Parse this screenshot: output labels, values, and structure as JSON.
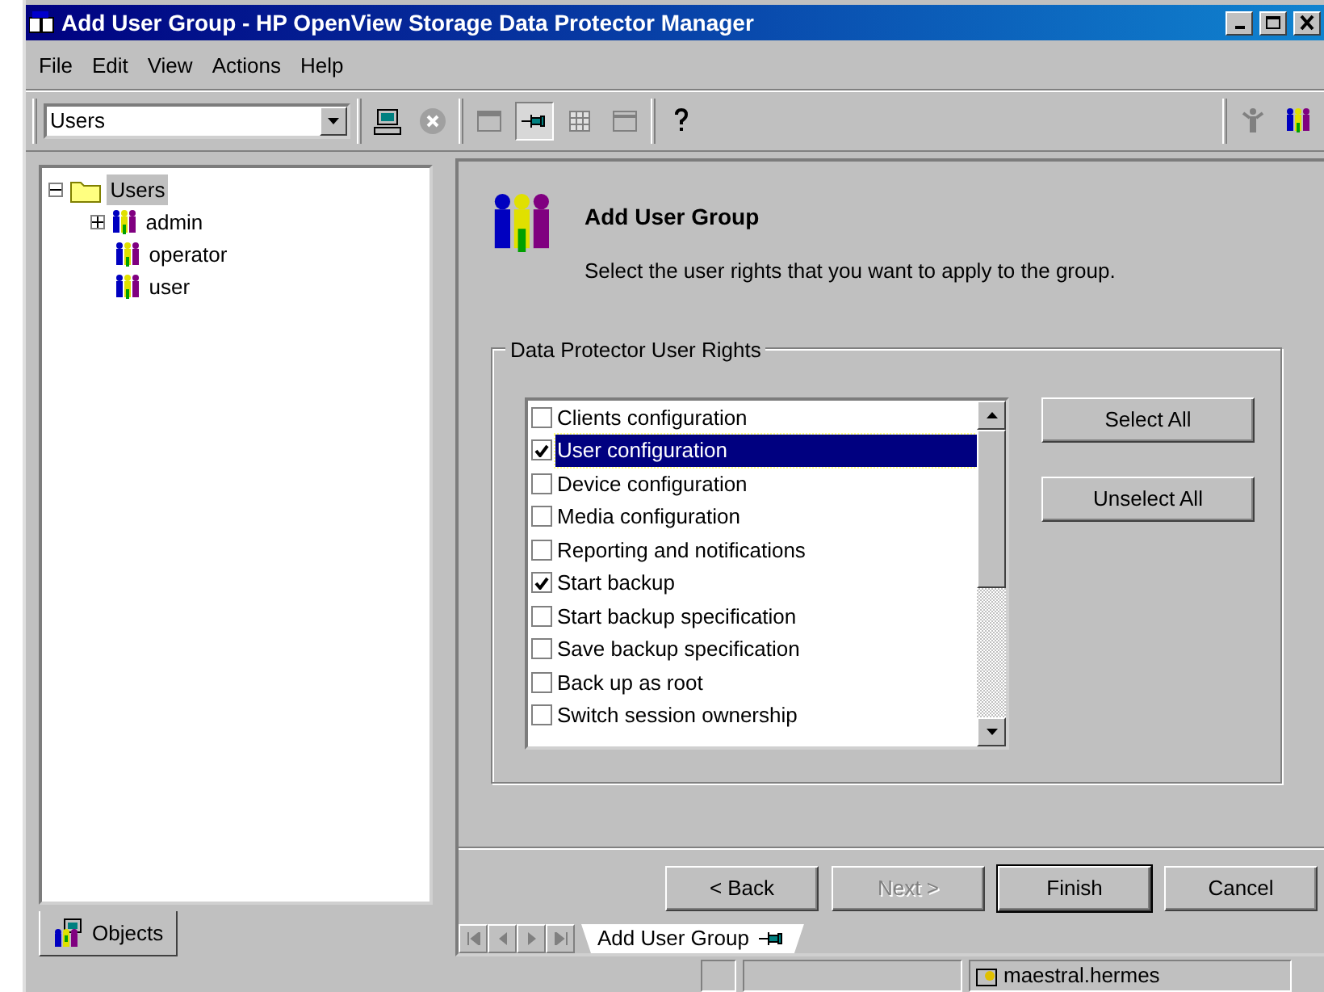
{
  "window": {
    "title": "Add User Group - HP OpenView Storage Data Protector Manager"
  },
  "menu": [
    "File",
    "Edit",
    "View",
    "Actions",
    "Help"
  ],
  "toolbar": {
    "context": {
      "value": "Users"
    }
  },
  "tree": [
    {
      "label": "Users",
      "selected": true,
      "expanded": true,
      "children": [
        {
          "label": "admin",
          "selected": false,
          "expanded": false
        },
        {
          "label": "operator",
          "selected": false
        },
        {
          "label": "user",
          "selected": false
        }
      ]
    }
  ],
  "left_tab": {
    "label": "Objects"
  },
  "wizard": {
    "title": "Add User Group",
    "subtitle": "Select the user rights that you want to apply to the group."
  },
  "rights": {
    "legend": "Data Protector User Rights",
    "items": [
      {
        "label": "Clients configuration",
        "checked": false,
        "selected": false
      },
      {
        "label": "User configuration",
        "checked": true,
        "selected": true
      },
      {
        "label": "Device configuration",
        "checked": false,
        "selected": false
      },
      {
        "label": "Media configuration",
        "checked": false,
        "selected": false
      },
      {
        "label": "Reporting and notifications",
        "checked": false,
        "selected": false
      },
      {
        "label": "Start backup",
        "checked": true,
        "selected": false
      },
      {
        "label": "Start backup specification",
        "checked": false,
        "selected": false
      },
      {
        "label": "Save backup specification",
        "checked": false,
        "selected": false
      },
      {
        "label": "Back up as root",
        "checked": false,
        "selected": false
      },
      {
        "label": "Switch session ownership",
        "checked": false,
        "selected": false
      }
    ]
  },
  "side_buttons": [
    "Select All",
    "Unselect All"
  ],
  "nav_buttons": [
    {
      "label": "< Back",
      "disabled": false
    },
    {
      "label": "Next >",
      "disabled": true
    },
    {
      "label": "Finish",
      "disabled": false
    },
    {
      "label": "Cancel",
      "disabled": false
    }
  ],
  "doc_tabs": [
    {
      "label": "Add User Group",
      "selected": true
    }
  ],
  "status_bar": {
    "host": "maestral.hermes"
  }
}
